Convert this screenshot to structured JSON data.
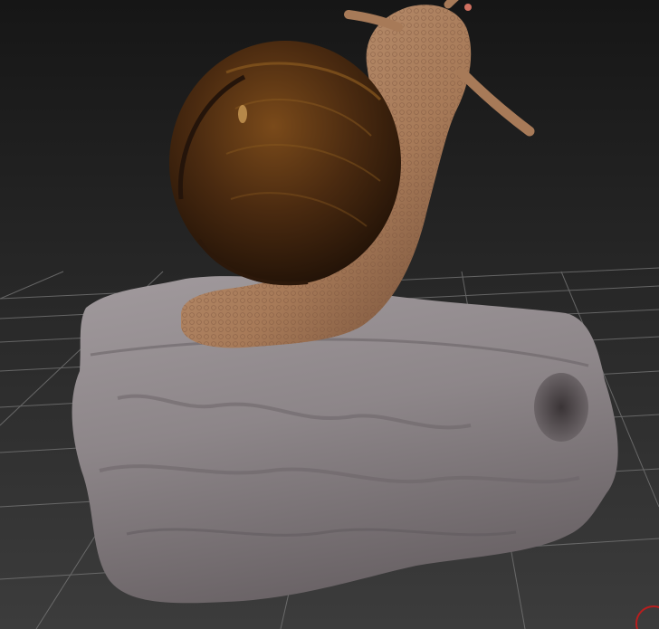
{
  "viewport": {
    "background_top": "#161616",
    "background_bottom": "#3c3c3c",
    "grid_color": "#7a7a7a"
  },
  "scene": {
    "object": "snail-on-rock",
    "shell_color": "#4a2a10",
    "shell_highlight": "#8a5a20",
    "body_color": "#b48462",
    "body_shadow": "#6e4a34",
    "rock_color": "#8d8689",
    "rock_shadow": "#5e585b"
  },
  "corner": {
    "icon": "red-circle-icon",
    "color": "#b81e1e"
  }
}
